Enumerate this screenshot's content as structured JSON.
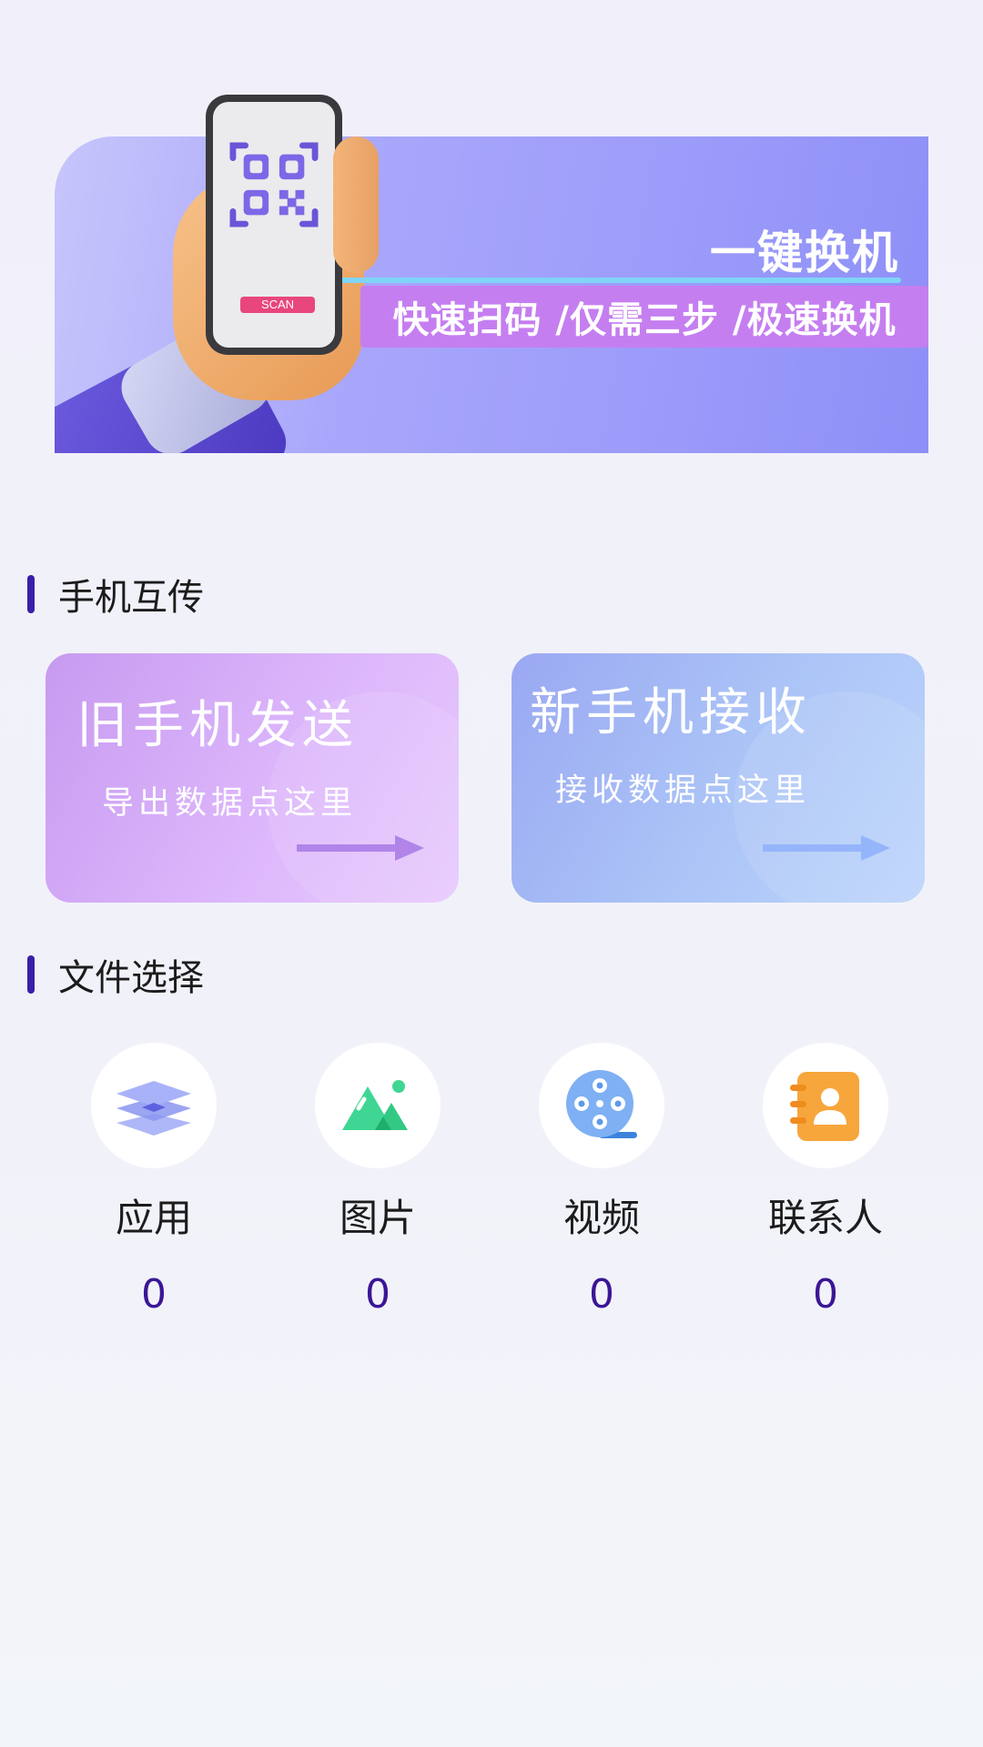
{
  "banner": {
    "title": "一键换机",
    "subtitle": "快速扫码 /仅需三步 /极速换机",
    "scan_label": "SCAN"
  },
  "transfer_section": {
    "title": "手机互传",
    "send_card": {
      "title": "旧手机发送",
      "subtitle": "导出数据点这里"
    },
    "receive_card": {
      "title": "新手机接收",
      "subtitle": "接收数据点这里"
    }
  },
  "file_section": {
    "title": "文件选择",
    "items": [
      {
        "label": "应用",
        "count": "0",
        "icon": "layers-icon"
      },
      {
        "label": "图片",
        "count": "0",
        "icon": "picture-icon"
      },
      {
        "label": "视频",
        "count": "0",
        "icon": "video-reel-icon"
      },
      {
        "label": "联系人",
        "count": "0",
        "icon": "contact-book-icon"
      }
    ]
  },
  "colors": {
    "accent": "#3a1fa8",
    "count_text": "#3c1696",
    "send_card": "#d3a9f7",
    "receive_card": "#aabff6"
  }
}
